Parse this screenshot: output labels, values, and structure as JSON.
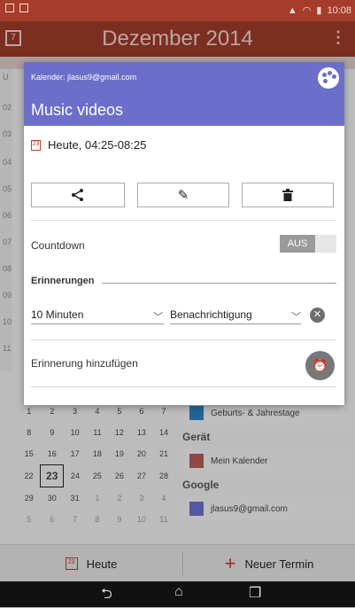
{
  "statusbar": {
    "time": "10:08"
  },
  "appbar": {
    "title": "Dezember 2014",
    "cal_icon_day": "7",
    "menu_glyph": "⋮"
  },
  "timecol": [
    "U",
    "02",
    "03",
    "04",
    "05",
    "06",
    "07",
    "08",
    "09",
    "10",
    "11"
  ],
  "minical": {
    "rows": [
      [
        "1",
        "2",
        "3",
        "4",
        "5",
        "6",
        "7"
      ],
      [
        "8",
        "9",
        "10",
        "11",
        "12",
        "13",
        "14"
      ],
      [
        "15",
        "16",
        "17",
        "18",
        "19",
        "20",
        "21"
      ],
      [
        "22",
        "23",
        "24",
        "25",
        "26",
        "27",
        "28"
      ],
      [
        "29",
        "30",
        "31",
        "1",
        "2",
        "3",
        "4"
      ],
      [
        "5",
        "6",
        "7",
        "8",
        "9",
        "10",
        "11"
      ]
    ]
  },
  "calendars": {
    "birthdays": "Geburts- & Jahrestage",
    "device_header": "Gerät",
    "my_calendar": "Mein Kalender",
    "google_header": "Google",
    "google_account": "jlasus9@gmail.com",
    "colors": {
      "birthdays": "#2a7fc1",
      "my_calendar": "#b55a57",
      "google": "#6b6fc9"
    }
  },
  "bottombar": {
    "today_label": "Heute",
    "today_icon_day": "23",
    "new_label": "Neuer Termin"
  },
  "dialog": {
    "calendar_label": "Kalender: jlasus9@gmail.com",
    "title": "Music videos",
    "time_text": "Heute, 04:25-08:25",
    "time_icon_day": "23",
    "buttons": {
      "share": "share-icon",
      "edit": "pencil-icon",
      "delete": "trash-icon"
    },
    "countdown_label": "Countdown",
    "countdown_state": "AUS",
    "reminders_header": "Erinnerungen",
    "reminder_time": "10 Minuten",
    "reminder_type": "Benachrichtigung",
    "add_reminder": "Erinnerung hinzufügen",
    "header_color": "#6b6fc9"
  }
}
